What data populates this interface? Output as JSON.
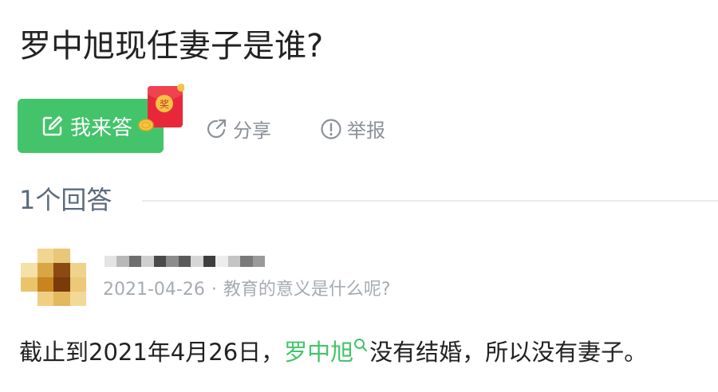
{
  "question": {
    "title": "罗中旭现任妻子是谁?"
  },
  "toolbar": {
    "answer_label": "我来答",
    "share_label": "分享",
    "report_label": "举报",
    "reward_badge_text": "奖"
  },
  "answers_section": {
    "count_label": "1个回答"
  },
  "answer": {
    "date": "2021-04-26",
    "separator": "·",
    "source_question": "教育的意义是什么呢?",
    "text_before": "截止到2021年4月26日，",
    "keyword_link": "罗中旭",
    "text_after": "没有结婚，所以没有妻子。"
  },
  "colors": {
    "accent_green": "#43c46b",
    "muted_gray": "#8a9199",
    "redpacket_red": "#e8283a",
    "coin_gold": "#f6c343"
  }
}
